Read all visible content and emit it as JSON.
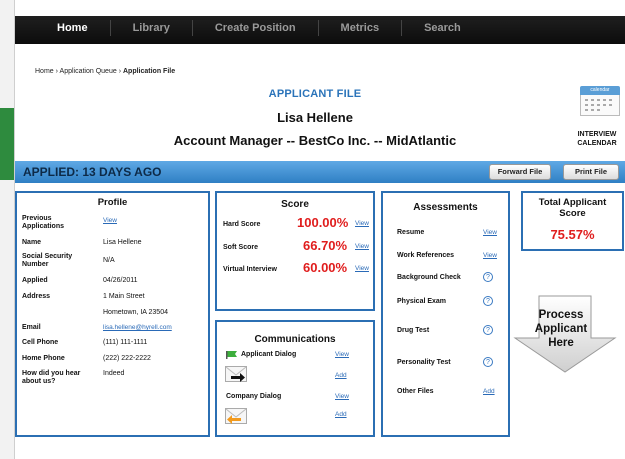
{
  "nav": {
    "items": [
      "Home",
      "Library",
      "Create Position",
      "Metrics",
      "Search"
    ]
  },
  "breadcrumb": {
    "home": "Home",
    "sep": " › ",
    "queue": "Application Queue",
    "current": "Application File"
  },
  "header": {
    "label": "APPLICANT FILE",
    "name": "Lisa Hellene",
    "position": "Account Manager -- BestCo Inc. -- MidAtlantic",
    "calendar_label_1": "INTERVIEW",
    "calendar_label_2": "CALENDAR",
    "calendar_icon_text": "calendar"
  },
  "banner": {
    "applied": "APPLIED:  13 DAYS AGO",
    "forward_label": "Forward File",
    "print_label": "Print File"
  },
  "profile": {
    "title": "Profile",
    "previous_label": "Previous Applications",
    "previous_link": "View",
    "name_label": "Name",
    "name_value": "Lisa Hellene",
    "ssn_label": "Social Security Number",
    "ssn_value": "N/A",
    "applied_label": "Applied",
    "applied_value": "04/26/2011",
    "address_label": "Address",
    "address_line1": "1 Main Street",
    "address_line2": "Hometown, IA 23504",
    "email_label": "Email",
    "email_value": "lisa.hellene@hyrell.com",
    "cell_label": "Cell Phone",
    "cell_value": "(111) 111-1111",
    "home_label": "Home Phone",
    "home_value": "(222) 222-2222",
    "hear_label": "How did you hear about us?",
    "hear_value": "Indeed"
  },
  "score": {
    "title": "Score",
    "rows": [
      {
        "label": "Hard Score",
        "value": "100.00%",
        "link": "View"
      },
      {
        "label": "Soft Score",
        "value": "66.70%",
        "link": "View"
      },
      {
        "label": "Virtual Interview",
        "value": "60.00%",
        "link": "View"
      }
    ]
  },
  "communications": {
    "title": "Communications",
    "applicant_label": "Applicant Dialog",
    "applicant_view": "View",
    "applicant_add": "Add",
    "company_label": "Company Dialog",
    "company_view": "View",
    "company_add": "Add"
  },
  "assessments": {
    "title": "Assessments",
    "resume_label": "Resume",
    "resume_link": "View",
    "work_label": "Work References",
    "work_link": "View",
    "bg_label": "Background Check",
    "physical_label": "Physical Exam",
    "drug_label": "Drug Test",
    "personality_label": "Personality Test",
    "other_label": "Other Files",
    "other_link": "Add",
    "q": "?"
  },
  "total": {
    "title": "Total Applicant Score",
    "value": "75.57%"
  },
  "process": {
    "line1": "Process",
    "line2": "Applicant",
    "line3": "Here"
  },
  "colors": {
    "accent": "#2b6fb3",
    "score_red": "#e01d1d",
    "link": "#2a6ab7",
    "banner": "#4a95d6"
  }
}
